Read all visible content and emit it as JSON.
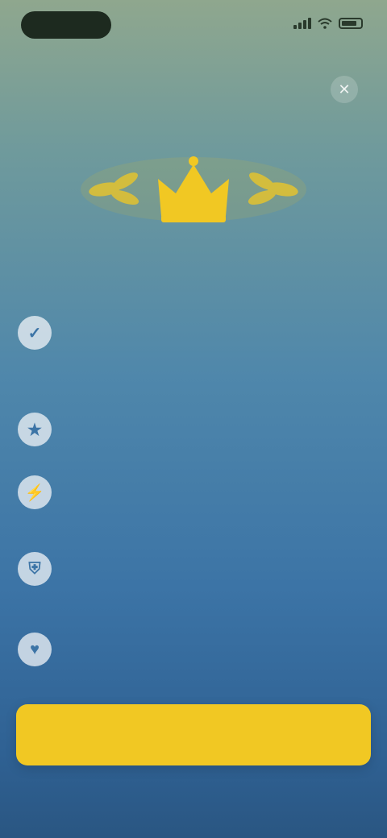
{
  "status_bar": {
    "time": ""
  },
  "close": {
    "glyph": "✕"
  },
  "headline": "",
  "features": [
    {
      "icon": "check-icon",
      "title": "",
      "desc": ""
    },
    {
      "icon": "star-icon",
      "title": "",
      "desc": ""
    },
    {
      "icon": "bolt-icon",
      "title": "",
      "desc": ""
    },
    {
      "icon": "shield-icon",
      "title": "",
      "desc": ""
    },
    {
      "icon": "heart-icon",
      "title": "",
      "desc": ""
    }
  ],
  "cta": {
    "label": ""
  },
  "colors": {
    "accent": "#f1c823",
    "background_top": "#8fa78e",
    "background_bottom": "#2a5682"
  }
}
